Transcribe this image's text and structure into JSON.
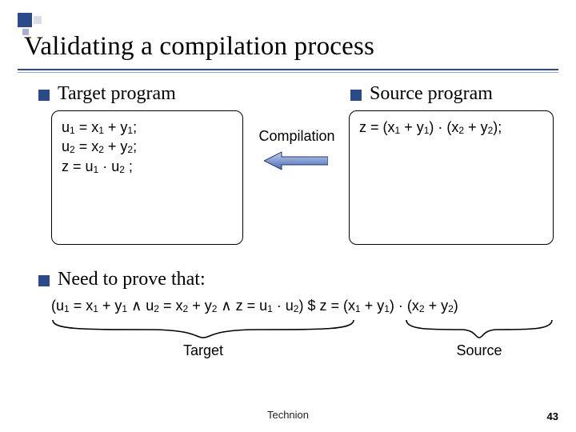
{
  "title": "Validating a compilation process",
  "left": {
    "heading": "Target program",
    "code_html": "u<sub>1</sub> = x<sub>1</sub> + y<sub>1</sub>;<br>u<sub>2</sub> = x<sub>2</sub> + y<sub>2</sub>;<br>z = u<sub>1</sub> · u<sub>2</sub> ;"
  },
  "right": {
    "heading": "Source program",
    "code_html": "z = (x<sub>1</sub> + y<sub>1</sub>) · (x<sub>2</sub> + y<sub>2</sub>);"
  },
  "arrow_label": "Compilation",
  "prove": {
    "heading": "Need to prove that:",
    "formula_html": "(u<sub>1</sub> = x<sub>1</sub> + y<sub>1</sub> ∧ u<sub>2</sub> = x<sub>2</sub> + y<sub>2</sub>  ∧  z = u<sub>1</sub> · u<sub>2</sub>)  $  z = (x<sub>1</sub> + y<sub>1</sub>) · (x<sub>2</sub> + y<sub>2</sub>)",
    "target_brace": "Target",
    "source_brace": "Source"
  },
  "footer": {
    "org": "Technion",
    "page": "43"
  }
}
